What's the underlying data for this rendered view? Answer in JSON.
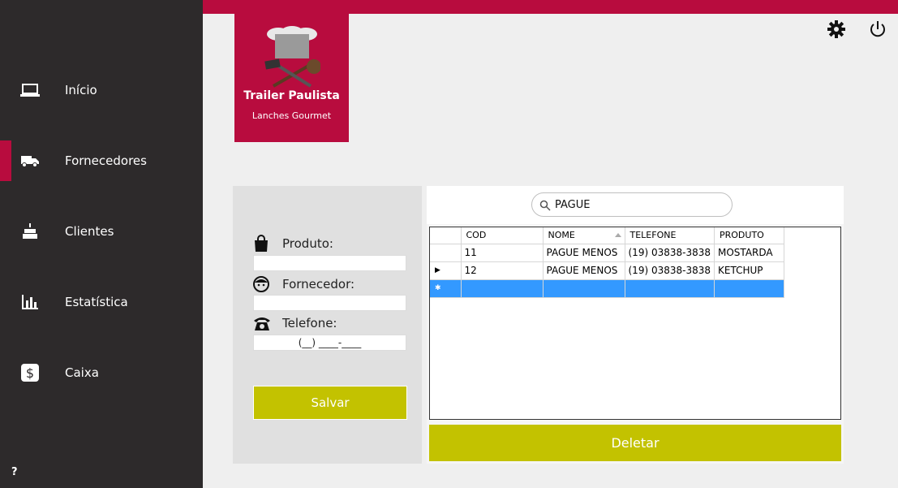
{
  "sidebar": {
    "items": [
      {
        "label": "Início",
        "icon": "laptop-icon"
      },
      {
        "label": "Fornecedores",
        "icon": "truck-icon",
        "active": true
      },
      {
        "label": "Clientes",
        "icon": "cake-icon"
      },
      {
        "label": "Estatística",
        "icon": "bar-chart-icon"
      },
      {
        "label": "Caixa",
        "icon": "dollar-icon"
      }
    ],
    "help": "?"
  },
  "header": {
    "settings_icon": "gear-icon",
    "power_icon": "power-icon"
  },
  "logo": {
    "title": "Trailer Paulista",
    "subtitle": "Lanches Gourmet"
  },
  "form": {
    "produto_label": "Produto:",
    "produto_value": "",
    "fornecedor_label": "Fornecedor:",
    "fornecedor_value": "",
    "telefone_label": "Telefone:",
    "telefone_value": "(__) ____-____",
    "save_label": "Salvar"
  },
  "search": {
    "value": "PAGUE"
  },
  "table": {
    "columns": [
      "COD",
      "NOME",
      "TELEFONE",
      "PRODUTO"
    ],
    "rows": [
      [
        "11",
        "PAGUE MENOS",
        "(19) 03838-3838",
        "MOSTARDA"
      ],
      [
        "12",
        "PAGUE MENOS",
        "(19) 03838-3838",
        "KETCHUP"
      ]
    ]
  },
  "delete_label": "Deletar",
  "colors": {
    "accent": "#b80c3e",
    "sidebar": "#2d2a2b",
    "button": "#c3c200",
    "selection": "#3399ff"
  }
}
